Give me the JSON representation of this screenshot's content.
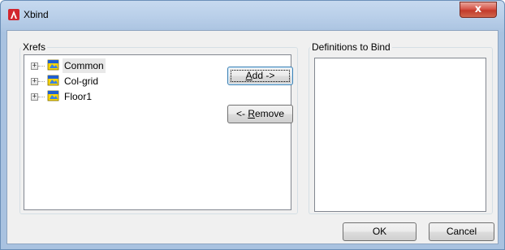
{
  "window": {
    "title": "Xbind",
    "close_glyph": "x",
    "colors": {
      "titlebar": "#b9cfe9",
      "close_button": "#c23a2a",
      "app_icon": "#d2262e",
      "dialog_bg": "#f0f0f0"
    }
  },
  "xrefs": {
    "label": "Xrefs",
    "items": [
      {
        "label": "Common",
        "expander": "+",
        "icon": "xref-drawing-icon"
      },
      {
        "label": "Col-grid",
        "expander": "+",
        "icon": "xref-drawing-icon"
      },
      {
        "label": "Floor1",
        "expander": "+",
        "icon": "xref-drawing-icon"
      }
    ]
  },
  "buttons": {
    "add": {
      "label_mnemonic": "A",
      "label_rest": "dd ->"
    },
    "remove": {
      "label_prefix": "<- ",
      "label_mnemonic": "R",
      "label_rest": "emove"
    },
    "ok": "OK",
    "cancel": "Cancel"
  },
  "definitions": {
    "label": "Definitions to Bind",
    "items": []
  }
}
